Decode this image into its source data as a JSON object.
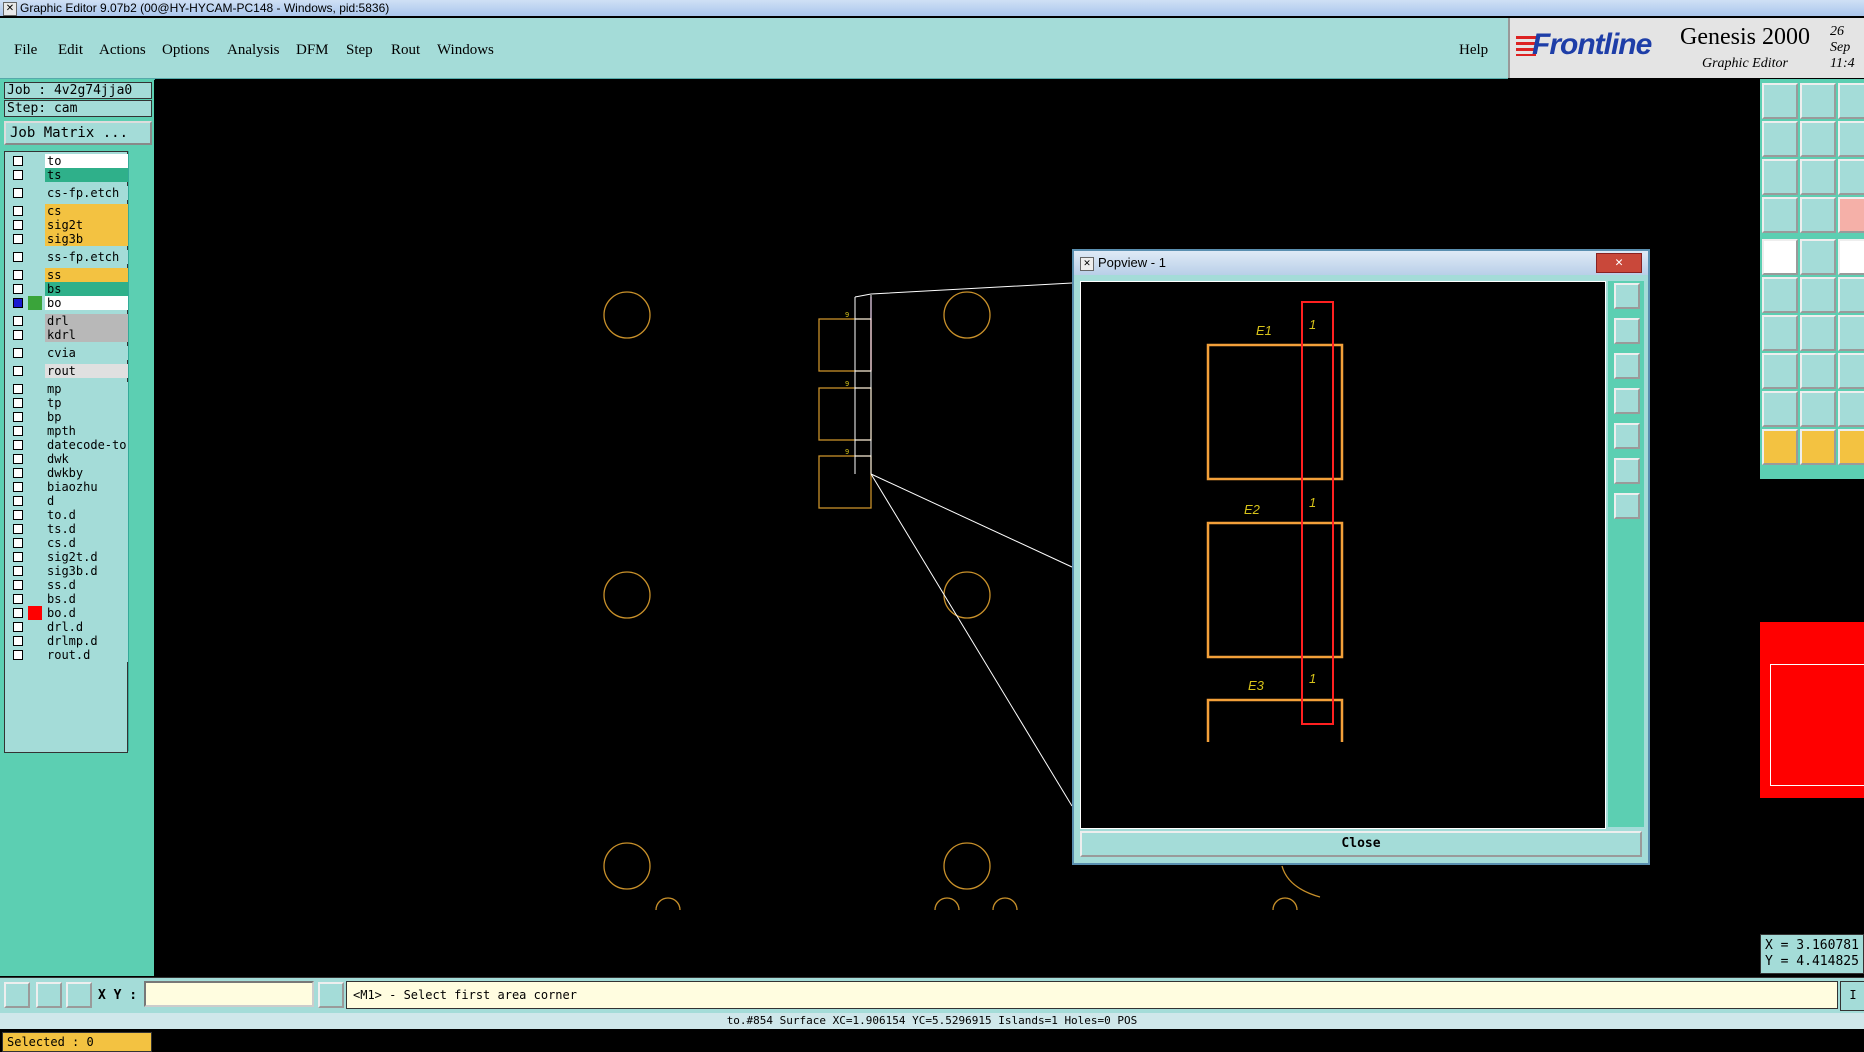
{
  "window": {
    "title": "Graphic Editor 9.07b2 (00@HY-HYCAM-PC148 - Windows, pid:5836)"
  },
  "menu": {
    "file": "File",
    "edit": "Edit",
    "actions": "Actions",
    "options": "Options",
    "analysis": "Analysis",
    "dfm": "DFM",
    "step": "Step",
    "rout": "Rout",
    "windows": "Windows",
    "help": "Help"
  },
  "brand": {
    "logo": "Frontline",
    "product": "Genesis 2000",
    "subtitle": "Graphic Editor",
    "date_line1": "26 Sep",
    "date_line2": "11:4"
  },
  "left": {
    "job": "Job : 4v2g74jja0",
    "step": "Step: cam",
    "job_matrix": "Job Matrix ...",
    "selected": "Selected : 0"
  },
  "layers": [
    {
      "name": "to",
      "color": "#ffffff",
      "checked": false,
      "swatch": ""
    },
    {
      "name": "ts",
      "color": "#2fb08a",
      "checked": false,
      "swatch": ""
    },
    {
      "name": "cs-fp.etch",
      "color": "#a4dcd8",
      "checked": false,
      "swatch": ""
    },
    {
      "name": "cs",
      "color": "#f3c241",
      "checked": false,
      "swatch": ""
    },
    {
      "name": "sig2t",
      "color": "#f3c241",
      "checked": false,
      "swatch": ""
    },
    {
      "name": "sig3b",
      "color": "#f3c241",
      "checked": false,
      "swatch": ""
    },
    {
      "name": "ss-fp.etch",
      "color": "#a4dcd8",
      "checked": false,
      "swatch": ""
    },
    {
      "name": "ss",
      "color": "#f3c241",
      "checked": false,
      "swatch": ""
    },
    {
      "name": "bs",
      "color": "#2fb08a",
      "checked": false,
      "swatch": ""
    },
    {
      "name": "bo",
      "color": "#ffffff",
      "checked": true,
      "swatch": "#3aa43a"
    },
    {
      "name": "drl",
      "color": "#b8b8b8",
      "checked": false,
      "swatch": ""
    },
    {
      "name": "kdrl",
      "color": "#b8b8b8",
      "checked": false,
      "swatch": ""
    },
    {
      "name": "cvia",
      "color": "#a4dcd8",
      "checked": false,
      "swatch": ""
    },
    {
      "name": "rout",
      "color": "#e0e0e0",
      "checked": false,
      "swatch": ""
    },
    {
      "name": "mp",
      "color": "#a4dcd8",
      "checked": false,
      "swatch": ""
    },
    {
      "name": "tp",
      "color": "#a4dcd8",
      "checked": false,
      "swatch": ""
    },
    {
      "name": "bp",
      "color": "#a4dcd8",
      "checked": false,
      "swatch": ""
    },
    {
      "name": "mpth",
      "color": "#a4dcd8",
      "checked": false,
      "swatch": ""
    },
    {
      "name": "datecode-to",
      "color": "#a4dcd8",
      "checked": false,
      "swatch": ""
    },
    {
      "name": "dwk",
      "color": "#a4dcd8",
      "checked": false,
      "swatch": ""
    },
    {
      "name": "dwkby",
      "color": "#a4dcd8",
      "checked": false,
      "swatch": ""
    },
    {
      "name": "biaozhu",
      "color": "#a4dcd8",
      "checked": false,
      "swatch": ""
    },
    {
      "name": "d",
      "color": "#a4dcd8",
      "checked": false,
      "swatch": ""
    },
    {
      "name": "to.d",
      "color": "#a4dcd8",
      "checked": false,
      "swatch": ""
    },
    {
      "name": "ts.d",
      "color": "#a4dcd8",
      "checked": false,
      "swatch": ""
    },
    {
      "name": "cs.d",
      "color": "#a4dcd8",
      "checked": false,
      "swatch": ""
    },
    {
      "name": "sig2t.d",
      "color": "#a4dcd8",
      "checked": false,
      "swatch": ""
    },
    {
      "name": "sig3b.d",
      "color": "#a4dcd8",
      "checked": false,
      "swatch": ""
    },
    {
      "name": "ss.d",
      "color": "#a4dcd8",
      "checked": false,
      "swatch": ""
    },
    {
      "name": "bs.d",
      "color": "#a4dcd8",
      "checked": false,
      "swatch": ""
    },
    {
      "name": "bo.d",
      "color": "#a4dcd8",
      "checked": false,
      "swatch": "#ff0000"
    },
    {
      "name": "drl.d",
      "color": "#a4dcd8",
      "checked": false,
      "swatch": ""
    },
    {
      "name": "drlmp.d",
      "color": "#a4dcd8",
      "checked": false,
      "swatch": ""
    },
    {
      "name": "rout.d",
      "color": "#a4dcd8",
      "checked": false,
      "swatch": ""
    }
  ],
  "popview": {
    "title": "Popview - 1",
    "close_button": "Close",
    "close_icon": "close-icon",
    "labels": [
      "E1",
      "1",
      "E2",
      "1",
      "E3",
      "1"
    ]
  },
  "canvas": {
    "pad_labels": [
      "9",
      "9",
      "9"
    ]
  },
  "coords": {
    "x": "X = 3.160781",
    "y": "Y = 4.414825"
  },
  "bottom": {
    "xy_label": "X Y :",
    "xy_value": "",
    "prompt": "<M1> - Select first area corner",
    "right_tag": "I",
    "status": "to.#854 Surface XC=1.906154 YC=5.5296915 Islands=1 Holes=0 POS"
  },
  "colors": {
    "panel": "#a4dcd8",
    "accent": "#5ccfb2",
    "outline": "#f3a03a",
    "highlight": "#ff0000"
  }
}
